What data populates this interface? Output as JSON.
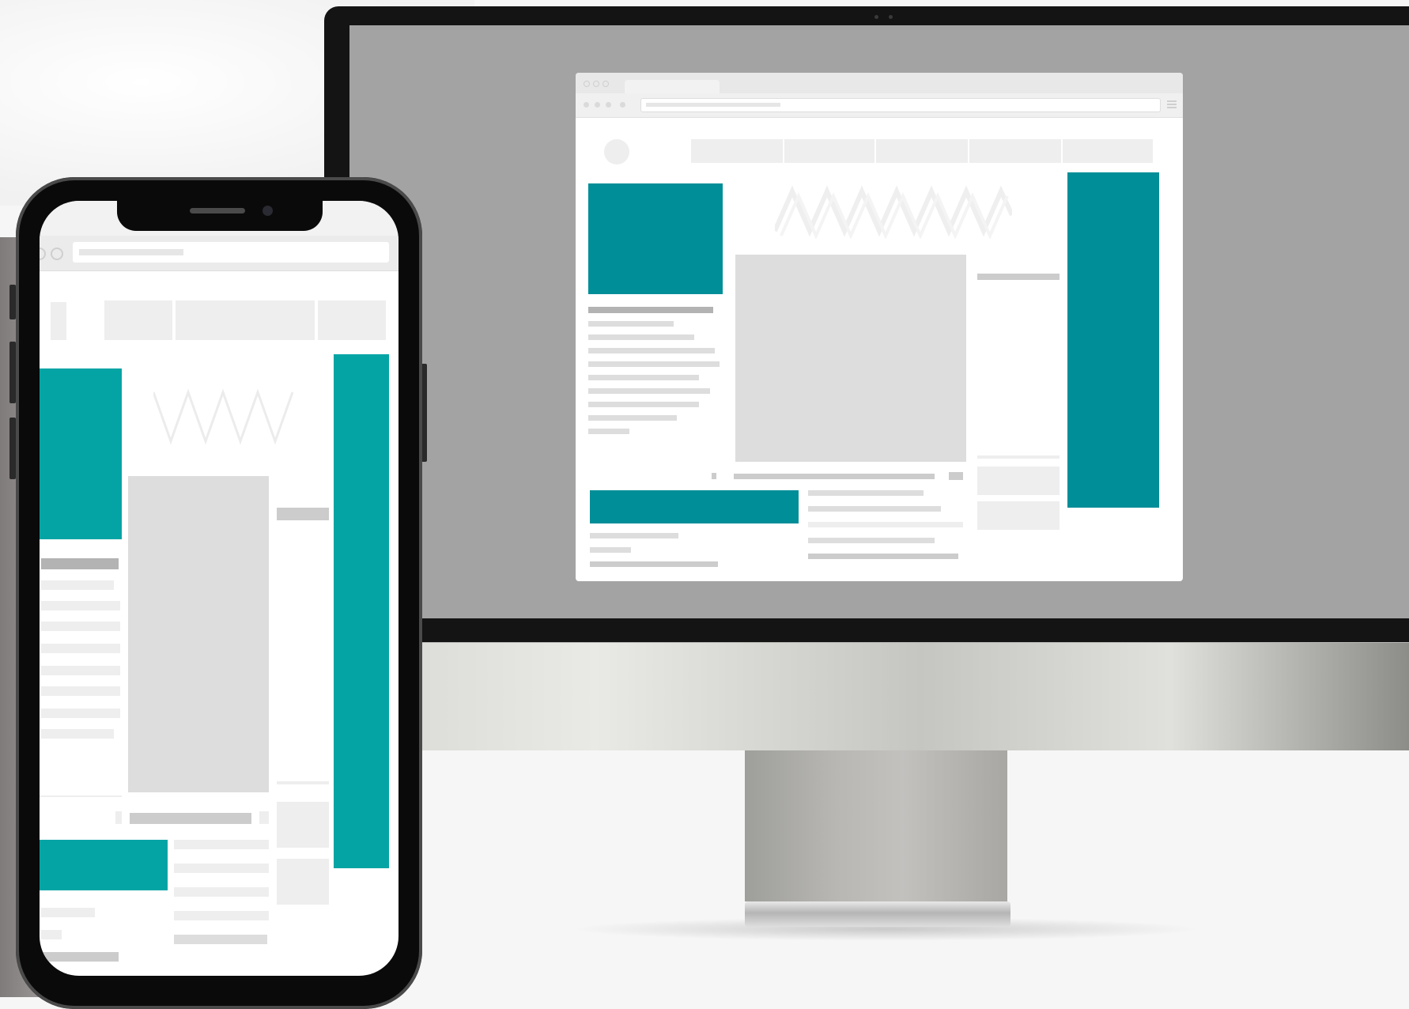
{
  "scene": {
    "devices": [
      "desktop-monitor",
      "smartphone"
    ],
    "content": "wireframe-webpage-mockup"
  },
  "colors": {
    "accent_desktop": "#008e98",
    "accent_phone": "#04a4a5",
    "placeholder_light": "#eeeeee",
    "placeholder_mid": "#dddddd",
    "placeholder_dark": "#b3b3b3",
    "monitor_screen_bg": "#a3a3a3",
    "device_frame": "#0a0a0a"
  },
  "icons": [
    "browser-menu-icon",
    "home-icon",
    "comment-icon",
    "zigzag-logo-icon"
  ]
}
